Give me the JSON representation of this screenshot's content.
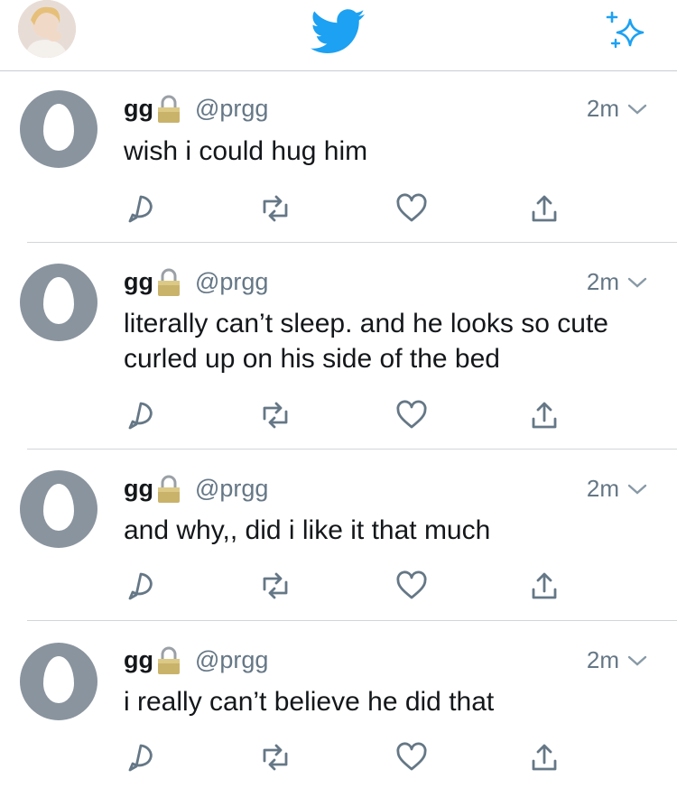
{
  "header": {
    "profile_icon": "profile-avatar",
    "logo_icon": "twitter-bird-icon",
    "compose_icon": "sparkle-icon",
    "brand_color": "#1da1f2"
  },
  "tweets": [
    {
      "name": "gg",
      "handle": "@prgg",
      "time": "2m",
      "text": "wish i could hug him"
    },
    {
      "name": "gg",
      "handle": "@prgg",
      "time": "2m",
      "text": "literally can’t sleep. and he looks so cute curled up on his side of the bed"
    },
    {
      "name": "gg",
      "handle": "@prgg",
      "time": "2m",
      "text": "and why,, did i like it that much"
    },
    {
      "name": "gg",
      "handle": "@prgg",
      "time": "2m",
      "text": "i really can’t believe he did that"
    }
  ],
  "colors": {
    "text_primary": "#14171a",
    "text_secondary": "#657786",
    "avatar_gray": "#8a949e",
    "lock_gold": "#c9b36b"
  }
}
